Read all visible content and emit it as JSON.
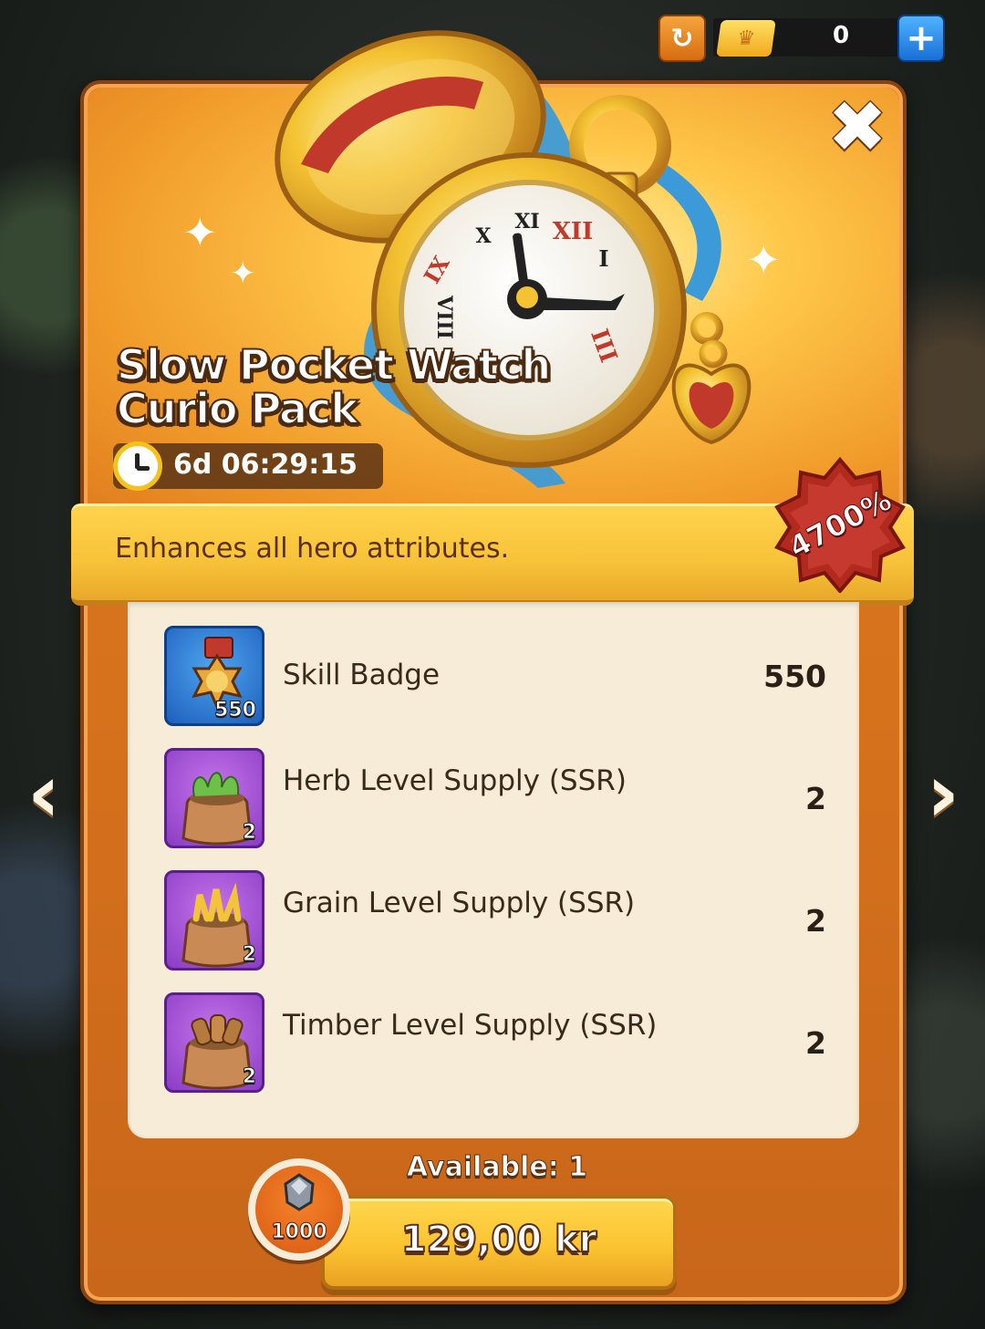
{
  "topbar": {
    "ticket_count": "0"
  },
  "pack": {
    "title": "Slow Pocket Watch Curio Pack",
    "timer": "6d 06:29:15",
    "description": "Enhances all hero attributes.",
    "value_badge": "4700%",
    "watch_numerals": [
      "XII",
      "I",
      "III",
      "VIII",
      "IX",
      "X",
      "XI",
      "X"
    ]
  },
  "items": [
    {
      "name": "Skill Badge",
      "amount": "550",
      "icon_qty": "550",
      "icon": "skill-badge-icon"
    },
    {
      "name": "Herb Level Supply (SSR)",
      "amount": "2",
      "icon_qty": "2",
      "icon": "herb-sack-icon"
    },
    {
      "name": "Grain Level Supply (SSR)",
      "amount": "2",
      "icon_qty": "2",
      "icon": "grain-sack-icon"
    },
    {
      "name": "Timber Level Supply (SSR)",
      "amount": "2",
      "icon_qty": "2",
      "icon": "timber-sack-icon"
    }
  ],
  "footer": {
    "available": "Available: 1",
    "price": "129,00 kr",
    "gem_bonus": "1000"
  },
  "colors": {
    "panel_orange": "#e6811f",
    "gold": "#ffd34d",
    "badge_red": "#b22a1e",
    "blue_icon": "#1d5fbd",
    "purple_icon": "#8a3cc4"
  }
}
